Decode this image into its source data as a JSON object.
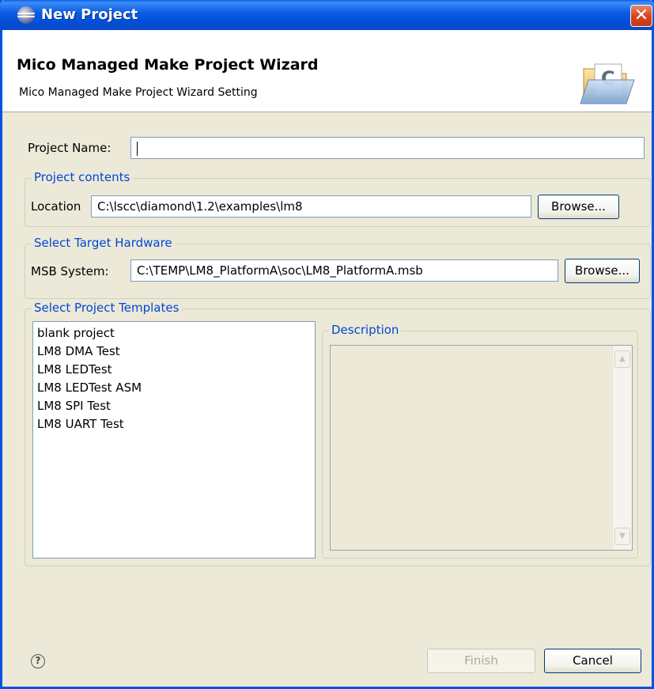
{
  "window": {
    "title": "New Project",
    "close_glyph": "✕"
  },
  "banner": {
    "title": "Mico Managed Make Project Wizard",
    "subtitle": "Mico Managed Make Project Wizard Setting",
    "icon": "folder-c-wizard-icon"
  },
  "project_name": {
    "label": "Project Name:",
    "value": ""
  },
  "project_contents": {
    "legend": "Project contents",
    "location_label": "Location",
    "location_value": "C:\\lscc\\diamond\\1.2\\examples\\lm8",
    "browse_label": "Browse..."
  },
  "target_hardware": {
    "legend": "Select Target Hardware",
    "msb_label": "MSB System:",
    "msb_value": "C:\\TEMP\\LM8_PlatformA\\soc\\LM8_PlatformA.msb",
    "browse_label": "Browse..."
  },
  "templates": {
    "legend": "Select Project Templates",
    "items": [
      "blank project",
      "LM8 DMA Test",
      "LM8 LEDTest",
      "LM8 LEDTest ASM",
      "LM8 SPI Test",
      "LM8 UART Test"
    ],
    "description_legend": "Description"
  },
  "footer": {
    "help_glyph": "?",
    "finish_label": "Finish",
    "cancel_label": "Cancel"
  },
  "colors": {
    "titlebar": "#0054e3",
    "legend_text": "#0046d5",
    "dialog_bg": "#ece9d8"
  }
}
